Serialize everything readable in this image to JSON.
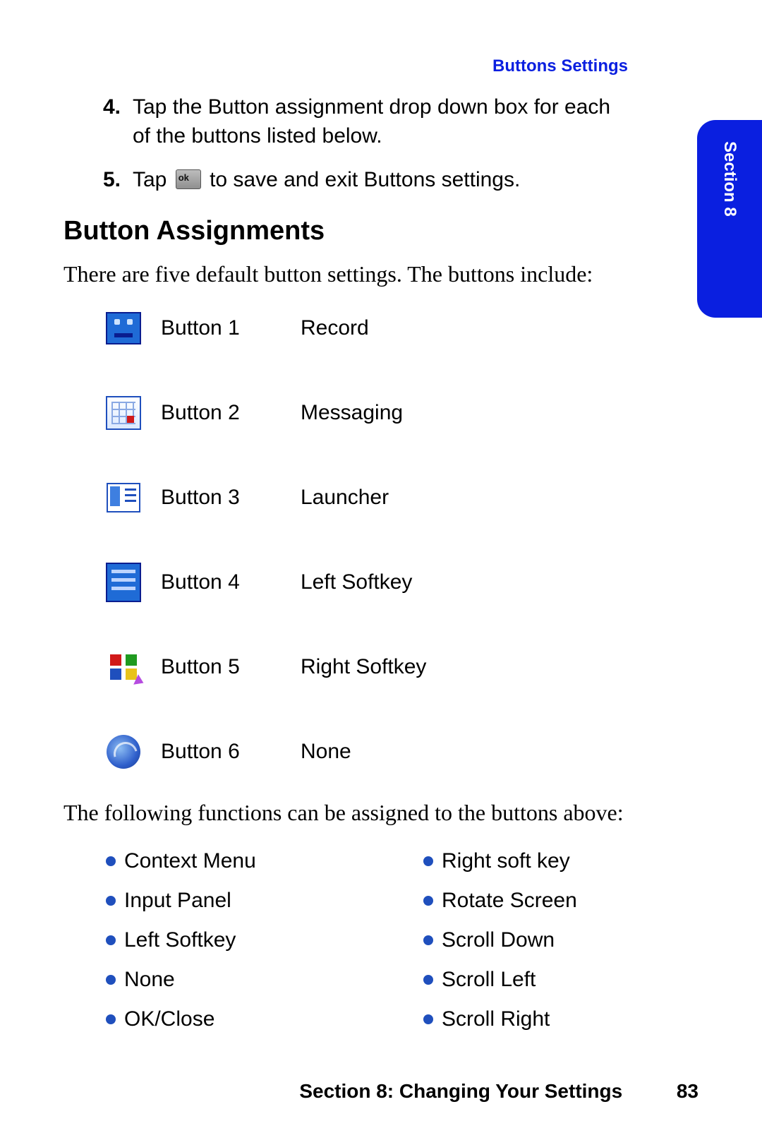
{
  "header": {
    "right_text": "Buttons Settings"
  },
  "side_tab": "Section 8",
  "steps": [
    {
      "num": "4.",
      "text": "Tap the Button assignment drop down box for each of the buttons listed below."
    },
    {
      "num": "5.",
      "text_before": "Tap ",
      "text_after": " to save and exit Buttons settings."
    }
  ],
  "section_heading": "Button Assignments",
  "intro_text": "There are five default button settings. The buttons include:",
  "buttons": [
    {
      "name": "Button 1",
      "value": "Record"
    },
    {
      "name": "Button 2",
      "value": "Messaging"
    },
    {
      "name": "Button 3",
      "value": "Launcher"
    },
    {
      "name": "Button 4",
      "value": "Left Softkey"
    },
    {
      "name": "Button 5",
      "value": "Right Softkey"
    },
    {
      "name": "Button 6",
      "value": "None"
    }
  ],
  "functions_intro": "The following functions can be assigned to the buttons above:",
  "functions_col1": [
    "Context Menu",
    "Input Panel",
    "Left Softkey",
    "None",
    "OK/Close"
  ],
  "functions_col2": [
    "Right soft key",
    "Rotate Screen",
    "Scroll Down",
    "Scroll Left",
    "Scroll Right"
  ],
  "footer": {
    "section": "Section 8: Changing Your Settings",
    "page": "83"
  }
}
